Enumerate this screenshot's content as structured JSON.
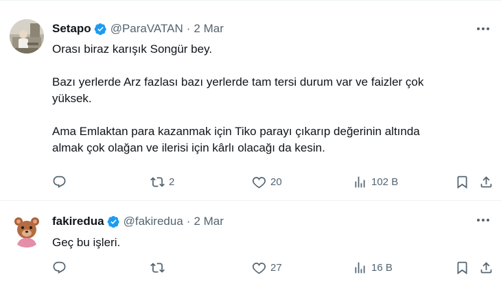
{
  "tweets": [
    {
      "author": {
        "name": "Setapo",
        "handle": "@ParaVATAN",
        "verified": true
      },
      "separator": "·",
      "date": "2 Mar",
      "paragraphs": [
        "Orası biraz karışık Songür bey.",
        "Bazı yerlerde Arz fazlası bazı yerlerde tam tersi durum var ve faizler çok\nyüksek.",
        "Ama Emlaktan para kazanmak için Tiko parayı çıkarıp değerinin altında\nalmak çok olağan ve ilerisi için kârlı olacağı da kesin."
      ],
      "stats": {
        "replies": "",
        "retweets": "2",
        "likes": "20",
        "views": "102 B"
      }
    },
    {
      "author": {
        "name": "fakiredua",
        "handle": "@fakiredua",
        "verified": true
      },
      "separator": "·",
      "date": "2 Mar",
      "paragraphs": [
        "Geç bu işleri."
      ],
      "stats": {
        "replies": "",
        "retweets": "",
        "likes": "27",
        "views": "16 B"
      }
    }
  ],
  "colors": {
    "verified": "#1d9bf0",
    "secondary_text": "#536471",
    "primary_text": "#0f1419",
    "divider": "#eff3f4"
  },
  "icons": [
    "reply-icon",
    "retweet-icon",
    "like-icon",
    "views-icon",
    "bookmark-icon",
    "share-icon",
    "more-icon",
    "verified-badge-icon"
  ]
}
